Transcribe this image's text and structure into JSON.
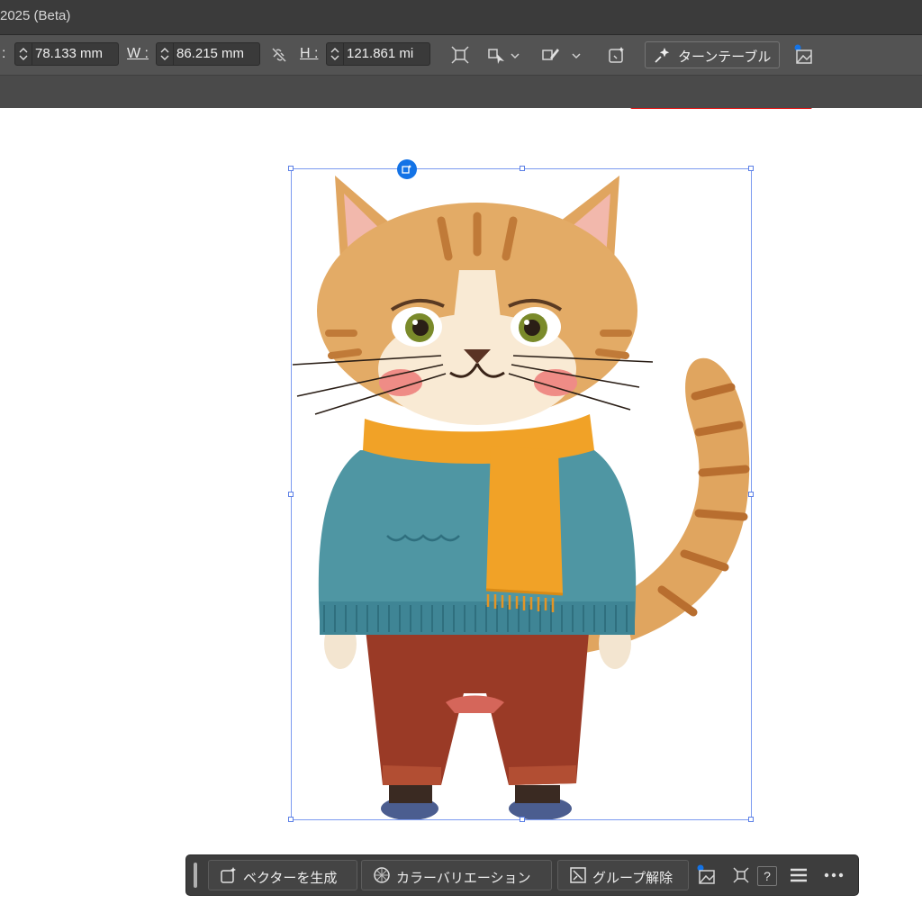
{
  "app": {
    "title": "2025 (Beta)"
  },
  "controls": {
    "x_label": ":",
    "x_value": "78.133 mm",
    "w_label": "W :",
    "w_value": "86.215 mm",
    "h_label": "H :",
    "h_value": "121.861 mi"
  },
  "toolbar": {
    "turntable_label": "ターンテーブル"
  },
  "floating_bar": {
    "generate_vector_label": "ベクターを生成",
    "color_variation_label": "カラーバリエーション",
    "ungroup_label": "グループ解除",
    "help_label": "?"
  },
  "colors": {
    "accent": "#1473e6",
    "highlight_underline": "#e21b1b",
    "selection": "#7b9af0"
  },
  "icons": [
    "spinner-icon",
    "link-icon",
    "transform-icon",
    "align-icon",
    "chevron-down-icon",
    "recolor-icon",
    "generative-icon",
    "sparkle-icon",
    "image-ai-icon",
    "vector-generate-icon",
    "color-wheel-icon",
    "ungroup-icon",
    "fit-icon",
    "help-icon",
    "menu-icon",
    "more-icon"
  ]
}
